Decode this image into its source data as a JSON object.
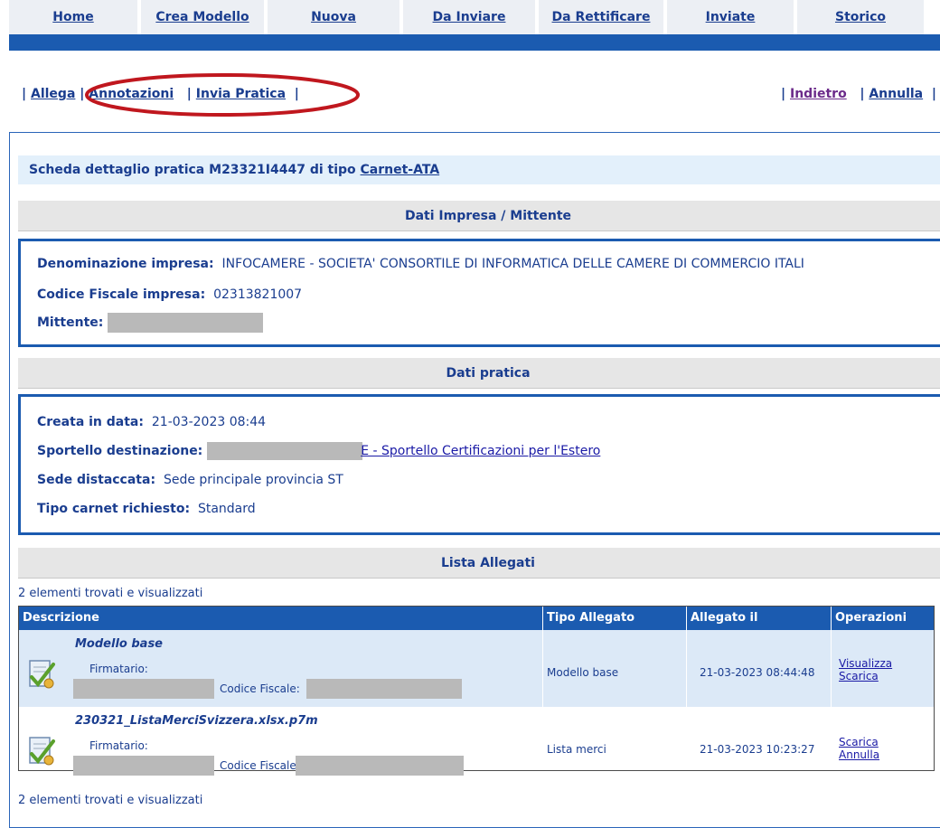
{
  "nav": {
    "tabs": [
      "Home",
      "Crea Modello",
      "Nuova",
      "Da Inviare",
      "Da Rettificare",
      "Inviate",
      "Storico"
    ]
  },
  "actions": {
    "left": [
      "Allega",
      "Annotazioni",
      "Invia Pratica"
    ],
    "right": [
      "Indietro",
      "Annulla"
    ]
  },
  "detail": {
    "title_prefix": "Scheda dettaglio pratica M23321I4447 di tipo ",
    "type_link": "Carnet-ATA"
  },
  "impresa": {
    "heading": "Dati Impresa / Mittente",
    "denominazione_label": "Denominazione impresa:",
    "denominazione_value": "INFOCAMERE - SOCIETA' CONSORTILE DI INFORMATICA DELLE CAMERE DI COMMERCIO ITALI",
    "cf_label": "Codice Fiscale impresa:",
    "cf_value": "02313821007",
    "mittente_label": "Mittente:"
  },
  "pratica": {
    "heading": "Dati pratica",
    "creata_label": "Creata in data:",
    "creata_value": "21-03-2023 08:44",
    "sportello_label": "Sportello destinazione:",
    "sportello_value": "E - Sportello Certificazioni per l'Estero",
    "sede_label": "Sede distaccata:",
    "sede_value": "Sede principale provincia ST",
    "tipo_label": "Tipo carnet richiesto:",
    "tipo_value": "Standard"
  },
  "allegati": {
    "heading": "Lista Allegati",
    "count_text": "2 elementi trovati e visualizzati",
    "columns": [
      "Descrizione",
      "Tipo Allegato",
      "Allegato il",
      "Operazioni"
    ],
    "firmatario_label": "Firmatario:",
    "cf_label": "Codice Fiscale:",
    "rows": [
      {
        "name": "Modello base",
        "tipo": "Modello base",
        "data": "21-03-2023 08:44:48",
        "ops": [
          "Visualizza",
          "Scarica"
        ]
      },
      {
        "name": "230321_ListaMerciSvizzera.xlsx.p7m",
        "tipo": "Lista merci",
        "data": "21-03-2023 10:23:27",
        "ops": [
          "Scarica",
          "Annulla"
        ]
      }
    ]
  },
  "colors": {
    "accent": "#1b5bb0",
    "highlight_oval": "#c0171e",
    "row_highlight": "#dce9f7"
  }
}
